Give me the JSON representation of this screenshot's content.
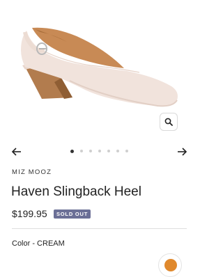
{
  "product": {
    "brand": "MIZ MOOZ",
    "title": "Haven Slingback Heel",
    "price": "$199.95",
    "status_badge": "SOLD OUT",
    "color_label": "Color - CREAM"
  },
  "gallery": {
    "slide_count": 7,
    "active_index": 0
  },
  "icons": {
    "zoom": "search-icon",
    "prev": "arrow-left-icon",
    "next": "arrow-right-icon"
  },
  "colors": {
    "badge_bg": "#6b6f96",
    "shoe_leather": "#f1e3dc",
    "heel_wood": "#b27c4e",
    "insole": "#c88a55",
    "swatch": "#e0892d"
  }
}
